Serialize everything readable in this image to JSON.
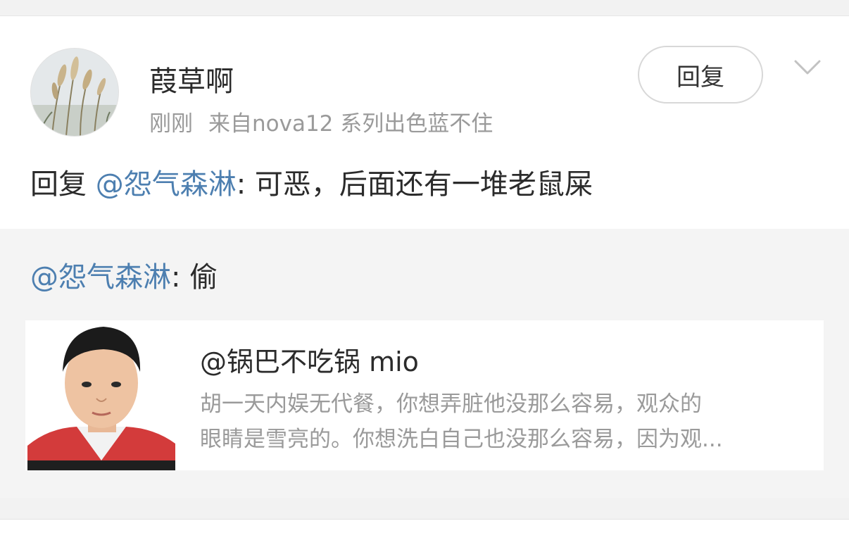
{
  "post": {
    "username": "葭草啊",
    "time": "刚刚",
    "source": "来自nova12 系列出色蓝不住",
    "reply_button": "回复",
    "more_icon": "chevron-down-icon",
    "avatar_icon": "pampas-grass-avatar",
    "comment": {
      "prefix": "回复",
      "mention": "@怨气森淋",
      "text": ": 可恶，后面还有一堆老鼠屎"
    }
  },
  "quoted": {
    "mention": "@怨气森淋",
    "text": ": 偷",
    "share_card": {
      "thumbnail_icon": "person-photo-thumbnail",
      "title": "@锅巴不吃锅 mio",
      "desc_line1": "胡一天内娱无代餐，你想弄脏他没那么容易，观众的",
      "desc_line2": "眼睛是雪亮的。你想洗白自己也没那么容易，因为观..."
    }
  },
  "colors": {
    "mention": "#4d7fb0",
    "text": "#2b2b2b",
    "meta": "#9a9a9a",
    "background": "#f2f2f2"
  }
}
